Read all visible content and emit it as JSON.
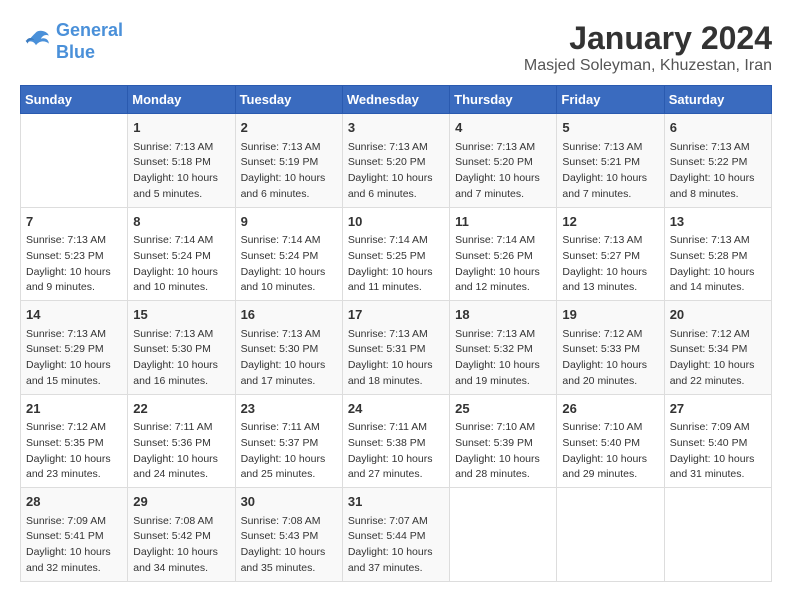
{
  "logo": {
    "line1": "General",
    "line2": "Blue"
  },
  "title": "January 2024",
  "subtitle": "Masjed Soleyman, Khuzestan, Iran",
  "weekdays": [
    "Sunday",
    "Monday",
    "Tuesday",
    "Wednesday",
    "Thursday",
    "Friday",
    "Saturday"
  ],
  "weeks": [
    [
      {
        "day": "",
        "info": ""
      },
      {
        "day": "1",
        "info": "Sunrise: 7:13 AM\nSunset: 5:18 PM\nDaylight: 10 hours\nand 5 minutes."
      },
      {
        "day": "2",
        "info": "Sunrise: 7:13 AM\nSunset: 5:19 PM\nDaylight: 10 hours\nand 6 minutes."
      },
      {
        "day": "3",
        "info": "Sunrise: 7:13 AM\nSunset: 5:20 PM\nDaylight: 10 hours\nand 6 minutes."
      },
      {
        "day": "4",
        "info": "Sunrise: 7:13 AM\nSunset: 5:20 PM\nDaylight: 10 hours\nand 7 minutes."
      },
      {
        "day": "5",
        "info": "Sunrise: 7:13 AM\nSunset: 5:21 PM\nDaylight: 10 hours\nand 7 minutes."
      },
      {
        "day": "6",
        "info": "Sunrise: 7:13 AM\nSunset: 5:22 PM\nDaylight: 10 hours\nand 8 minutes."
      }
    ],
    [
      {
        "day": "7",
        "info": "Sunrise: 7:13 AM\nSunset: 5:23 PM\nDaylight: 10 hours\nand 9 minutes."
      },
      {
        "day": "8",
        "info": "Sunrise: 7:14 AM\nSunset: 5:24 PM\nDaylight: 10 hours\nand 10 minutes."
      },
      {
        "day": "9",
        "info": "Sunrise: 7:14 AM\nSunset: 5:24 PM\nDaylight: 10 hours\nand 10 minutes."
      },
      {
        "day": "10",
        "info": "Sunrise: 7:14 AM\nSunset: 5:25 PM\nDaylight: 10 hours\nand 11 minutes."
      },
      {
        "day": "11",
        "info": "Sunrise: 7:14 AM\nSunset: 5:26 PM\nDaylight: 10 hours\nand 12 minutes."
      },
      {
        "day": "12",
        "info": "Sunrise: 7:13 AM\nSunset: 5:27 PM\nDaylight: 10 hours\nand 13 minutes."
      },
      {
        "day": "13",
        "info": "Sunrise: 7:13 AM\nSunset: 5:28 PM\nDaylight: 10 hours\nand 14 minutes."
      }
    ],
    [
      {
        "day": "14",
        "info": "Sunrise: 7:13 AM\nSunset: 5:29 PM\nDaylight: 10 hours\nand 15 minutes."
      },
      {
        "day": "15",
        "info": "Sunrise: 7:13 AM\nSunset: 5:30 PM\nDaylight: 10 hours\nand 16 minutes."
      },
      {
        "day": "16",
        "info": "Sunrise: 7:13 AM\nSunset: 5:30 PM\nDaylight: 10 hours\nand 17 minutes."
      },
      {
        "day": "17",
        "info": "Sunrise: 7:13 AM\nSunset: 5:31 PM\nDaylight: 10 hours\nand 18 minutes."
      },
      {
        "day": "18",
        "info": "Sunrise: 7:13 AM\nSunset: 5:32 PM\nDaylight: 10 hours\nand 19 minutes."
      },
      {
        "day": "19",
        "info": "Sunrise: 7:12 AM\nSunset: 5:33 PM\nDaylight: 10 hours\nand 20 minutes."
      },
      {
        "day": "20",
        "info": "Sunrise: 7:12 AM\nSunset: 5:34 PM\nDaylight: 10 hours\nand 22 minutes."
      }
    ],
    [
      {
        "day": "21",
        "info": "Sunrise: 7:12 AM\nSunset: 5:35 PM\nDaylight: 10 hours\nand 23 minutes."
      },
      {
        "day": "22",
        "info": "Sunrise: 7:11 AM\nSunset: 5:36 PM\nDaylight: 10 hours\nand 24 minutes."
      },
      {
        "day": "23",
        "info": "Sunrise: 7:11 AM\nSunset: 5:37 PM\nDaylight: 10 hours\nand 25 minutes."
      },
      {
        "day": "24",
        "info": "Sunrise: 7:11 AM\nSunset: 5:38 PM\nDaylight: 10 hours\nand 27 minutes."
      },
      {
        "day": "25",
        "info": "Sunrise: 7:10 AM\nSunset: 5:39 PM\nDaylight: 10 hours\nand 28 minutes."
      },
      {
        "day": "26",
        "info": "Sunrise: 7:10 AM\nSunset: 5:40 PM\nDaylight: 10 hours\nand 29 minutes."
      },
      {
        "day": "27",
        "info": "Sunrise: 7:09 AM\nSunset: 5:40 PM\nDaylight: 10 hours\nand 31 minutes."
      }
    ],
    [
      {
        "day": "28",
        "info": "Sunrise: 7:09 AM\nSunset: 5:41 PM\nDaylight: 10 hours\nand 32 minutes."
      },
      {
        "day": "29",
        "info": "Sunrise: 7:08 AM\nSunset: 5:42 PM\nDaylight: 10 hours\nand 34 minutes."
      },
      {
        "day": "30",
        "info": "Sunrise: 7:08 AM\nSunset: 5:43 PM\nDaylight: 10 hours\nand 35 minutes."
      },
      {
        "day": "31",
        "info": "Sunrise: 7:07 AM\nSunset: 5:44 PM\nDaylight: 10 hours\nand 37 minutes."
      },
      {
        "day": "",
        "info": ""
      },
      {
        "day": "",
        "info": ""
      },
      {
        "day": "",
        "info": ""
      }
    ]
  ]
}
